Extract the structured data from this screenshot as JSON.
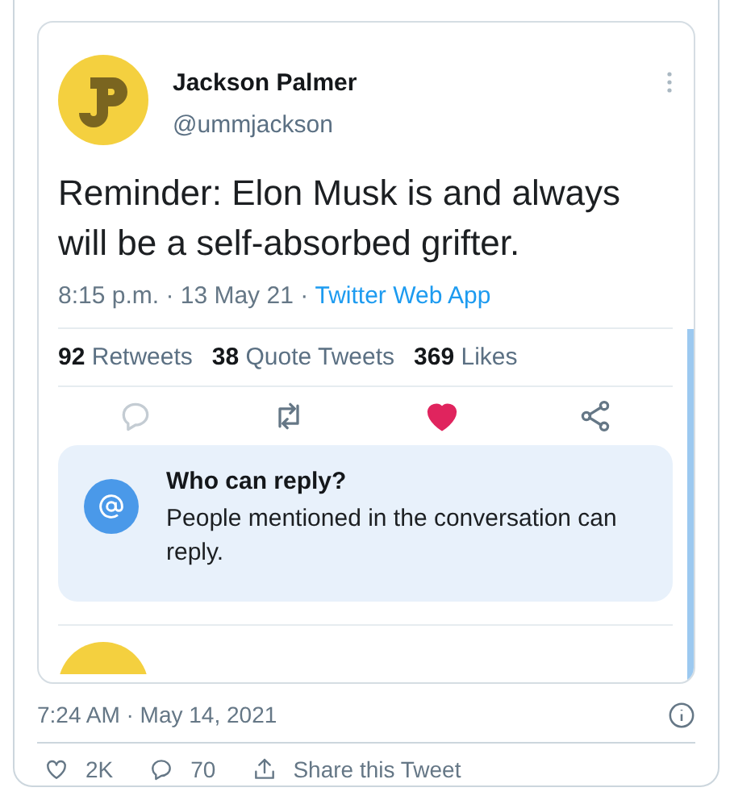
{
  "embedded_tweet": {
    "author": {
      "name": "Jackson Palmer",
      "handle": "@ummjackson"
    },
    "text": "Reminder: Elon Musk is and always will be a self-absorbed grifter.",
    "time": "8:15 p.m. · 13 May 21 · ",
    "source": "Twitter Web App",
    "stats": [
      {
        "count": "92",
        "label": "Retweets"
      },
      {
        "count": "38",
        "label": "Quote Tweets"
      },
      {
        "count": "369",
        "label": "Likes"
      }
    ],
    "liked": true,
    "reply_notice": {
      "title": "Who can reply?",
      "body": "People mentioned in the conversation can reply."
    }
  },
  "timestamp": "7:24 AM · May 14, 2021",
  "actions": [
    {
      "kind": "like",
      "label": "2K"
    },
    {
      "kind": "reply",
      "label": "70"
    },
    {
      "kind": "share",
      "label": "Share this Tweet"
    }
  ]
}
